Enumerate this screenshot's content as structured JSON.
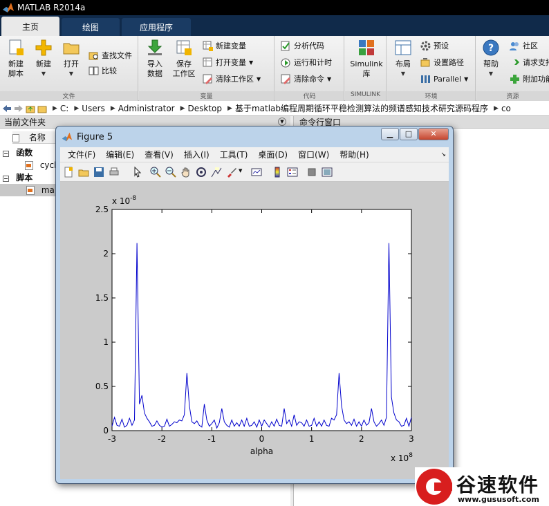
{
  "window": {
    "title": "MATLAB R2014a"
  },
  "tabs": [
    {
      "label": "主页"
    },
    {
      "label": "绘图"
    },
    {
      "label": "应用程序"
    }
  ],
  "ribbon": {
    "file": {
      "title": "文件",
      "new_script": "新建\n脚本",
      "new": "新建",
      "open": "打开",
      "find_files": "查找文件",
      "compare": "比较"
    },
    "variable": {
      "title": "变量",
      "import": "导入\n数据",
      "save_ws": "保存\n工作区",
      "new_var": "新建变量",
      "open_var": "打开变量",
      "clear_ws": "清除工作区"
    },
    "code": {
      "title": "代码",
      "analyze": "分析代码",
      "run_time": "运行和计时",
      "clear_cmd": "清除命令"
    },
    "simulink": {
      "title": "SIMULINK",
      "library": "Simulink\n库"
    },
    "env": {
      "title": "环境",
      "layout": "布局",
      "prefs": "预设",
      "set_path": "设置路径",
      "parallel": "Parallel"
    },
    "resources": {
      "title": "资源",
      "help": "帮助",
      "community": "社区",
      "request_support": "请求支持",
      "addons": "附加功能"
    }
  },
  "address": {
    "crumbs": [
      "C:",
      "Users",
      "Administrator",
      "Desktop",
      "基于matlab编程周期循环平稳检测算法的频谱感知技术研究源码程序",
      "co"
    ]
  },
  "current_folder": {
    "title": "当前文件夹",
    "column": "名称",
    "groups": [
      {
        "label": "函数",
        "items": [
          "cycl"
        ]
      },
      {
        "label": "脚本",
        "items": [
          "mai"
        ]
      }
    ]
  },
  "command_window": {
    "title": "命令行窗口"
  },
  "figure": {
    "title": "Figure 5",
    "menu": [
      "文件(F)",
      "编辑(E)",
      "查看(V)",
      "插入(I)",
      "工具(T)",
      "桌面(D)",
      "窗口(W)",
      "帮助(H)"
    ]
  },
  "chart_data": {
    "type": "line",
    "title": "",
    "xlabel": "alpha",
    "ylabel": "",
    "xlim": [
      -3,
      3
    ],
    "ylim": [
      0,
      2.5
    ],
    "x_multiplier": "x 10^8",
    "y_multiplier": "x 10^-8",
    "xticks": [
      "-3",
      "-2",
      "-1",
      "0",
      "1",
      "2",
      "3"
    ],
    "yticks": [
      "0",
      "0.5",
      "1",
      "1.5",
      "2",
      "2.5"
    ],
    "color": "#0000cc",
    "x": [
      -3.0,
      -2.95,
      -2.9,
      -2.85,
      -2.8,
      -2.75,
      -2.7,
      -2.65,
      -2.6,
      -2.55,
      -2.5,
      -2.45,
      -2.4,
      -2.35,
      -2.3,
      -2.25,
      -2.2,
      -2.15,
      -2.1,
      -2.05,
      -2.0,
      -1.95,
      -1.9,
      -1.85,
      -1.8,
      -1.75,
      -1.7,
      -1.65,
      -1.6,
      -1.55,
      -1.5,
      -1.45,
      -1.4,
      -1.35,
      -1.3,
      -1.25,
      -1.2,
      -1.15,
      -1.1,
      -1.05,
      -1.0,
      -0.95,
      -0.9,
      -0.85,
      -0.8,
      -0.75,
      -0.7,
      -0.65,
      -0.6,
      -0.55,
      -0.5,
      -0.45,
      -0.4,
      -0.35,
      -0.3,
      -0.25,
      -0.2,
      -0.15,
      -0.1,
      -0.05,
      0.0,
      0.05,
      0.1,
      0.15,
      0.2,
      0.25,
      0.3,
      0.35,
      0.4,
      0.45,
      0.5,
      0.55,
      0.6,
      0.65,
      0.7,
      0.75,
      0.8,
      0.85,
      0.9,
      0.95,
      1.0,
      1.05,
      1.1,
      1.15,
      1.2,
      1.25,
      1.3,
      1.35,
      1.4,
      1.45,
      1.5,
      1.55,
      1.6,
      1.65,
      1.7,
      1.75,
      1.8,
      1.85,
      1.9,
      1.95,
      2.0,
      2.05,
      2.1,
      2.15,
      2.2,
      2.25,
      2.3,
      2.35,
      2.4,
      2.45,
      2.5,
      2.55,
      2.6,
      2.65,
      2.7,
      2.75,
      2.8,
      2.85,
      2.9,
      2.95,
      3.0
    ],
    "y": [
      0.05,
      0.15,
      0.06,
      0.05,
      0.13,
      0.04,
      0.06,
      0.14,
      0.06,
      0.12,
      2.12,
      0.3,
      0.4,
      0.2,
      0.14,
      0.1,
      0.05,
      0.06,
      0.11,
      0.06,
      0.04,
      0.05,
      0.13,
      0.05,
      0.07,
      0.1,
      0.09,
      0.12,
      0.11,
      0.18,
      0.65,
      0.28,
      0.1,
      0.08,
      0.11,
      0.06,
      0.04,
      0.3,
      0.12,
      0.05,
      0.08,
      0.12,
      0.03,
      0.09,
      0.25,
      0.1,
      0.06,
      0.04,
      0.12,
      0.05,
      0.09,
      0.05,
      0.12,
      0.05,
      0.14,
      0.05,
      0.06,
      0.1,
      0.04,
      0.12,
      0.05,
      0.12,
      0.08,
      0.04,
      0.1,
      0.05,
      0.13,
      0.06,
      0.05,
      0.25,
      0.08,
      0.12,
      0.05,
      0.18,
      0.06,
      0.1,
      0.09,
      0.05,
      0.12,
      0.05,
      0.06,
      0.14,
      0.05,
      0.1,
      0.05,
      0.12,
      0.06,
      0.05,
      0.14,
      0.12,
      0.18,
      0.65,
      0.28,
      0.12,
      0.08,
      0.1,
      0.06,
      0.13,
      0.05,
      0.1,
      0.05,
      0.12,
      0.06,
      0.09,
      0.25,
      0.1,
      0.05,
      0.08,
      0.12,
      0.06,
      0.15,
      2.12,
      0.38,
      0.2,
      0.12,
      0.1,
      0.05,
      0.06,
      0.14,
      0.05,
      0.15,
      0.06
    ]
  },
  "watermark": {
    "brand": "谷速软件",
    "url": "www.gususoft.com"
  }
}
